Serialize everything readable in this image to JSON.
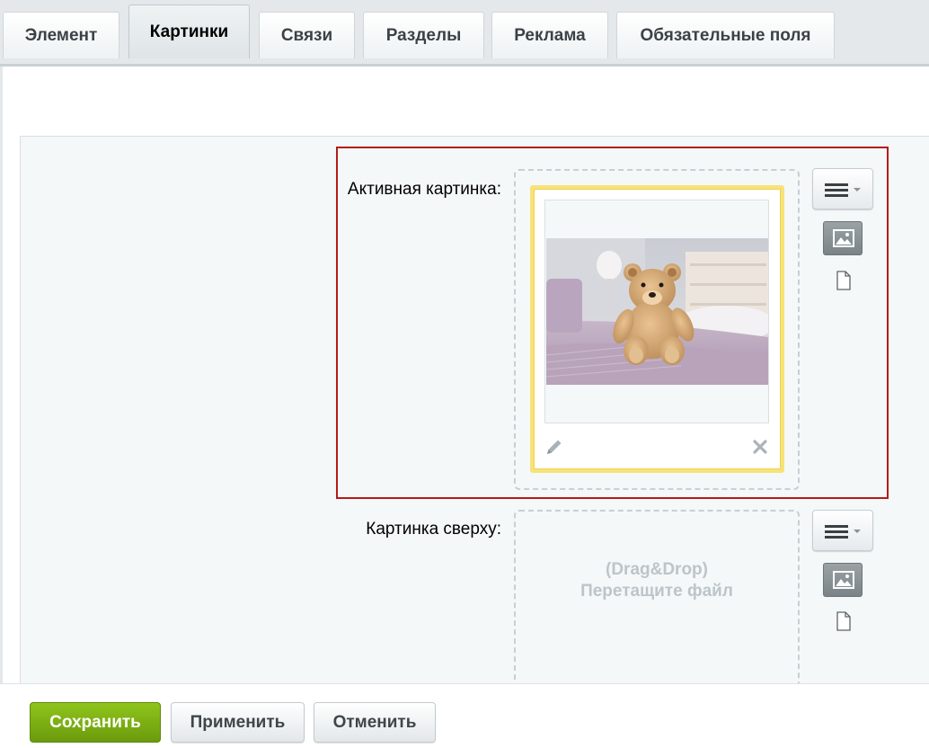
{
  "tabs": [
    {
      "label": "Элемент"
    },
    {
      "label": "Картинки"
    },
    {
      "label": "Связи"
    },
    {
      "label": "Разделы"
    },
    {
      "label": "Реклама"
    },
    {
      "label": "Обязательные поля"
    }
  ],
  "active_tab": "Картинки",
  "fields": {
    "active_picture": {
      "label": "Активная картинка:",
      "image_alt": "Плюшевый медведь на кровати"
    },
    "top_picture": {
      "label": "Картинка сверху:",
      "dnd_line1": "(Drag&Drop)",
      "dnd_line2": "Перетащите файл"
    }
  },
  "footer": {
    "save": "Сохранить",
    "apply": "Применить",
    "cancel": "Отменить"
  },
  "colors": {
    "accent_green": "#7bb014",
    "highlight_red": "#b31b1b",
    "card_yellow": "#f7e27a"
  },
  "icons": [
    "menu-icon",
    "chevron-down-icon",
    "image-icon",
    "file-icon",
    "pencil-icon",
    "close-icon"
  ]
}
